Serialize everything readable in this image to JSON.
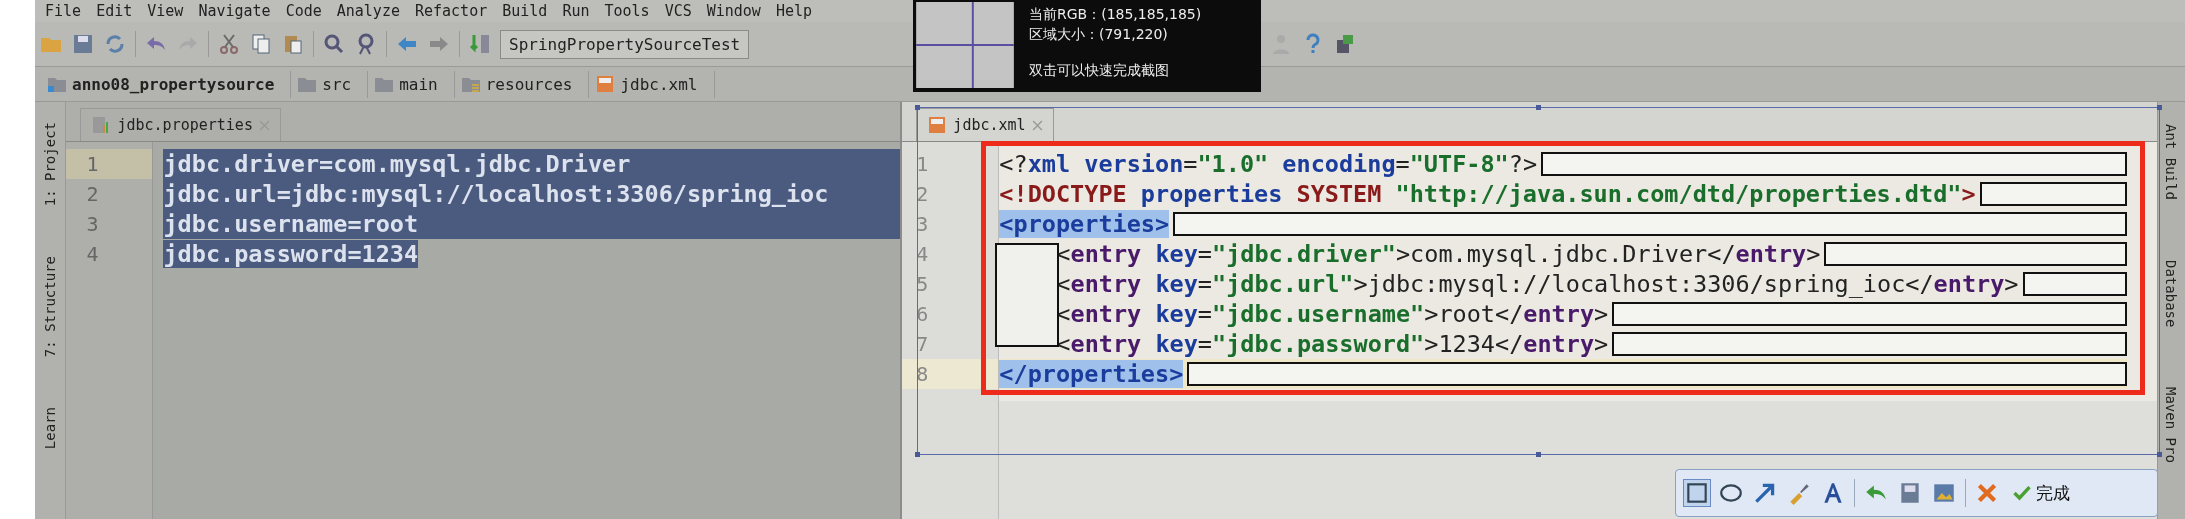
{
  "menu": [
    "File",
    "Edit",
    "View",
    "Navigate",
    "Code",
    "Analyze",
    "Refactor",
    "Build",
    "Run",
    "Tools",
    "VCS",
    "Window",
    "Help"
  ],
  "toolbar": {
    "run_config": "SpringPropertySourceTest"
  },
  "breadcrumbs": [
    {
      "label": "anno08_propertysource",
      "kind": "module"
    },
    {
      "label": "src",
      "kind": "folder"
    },
    {
      "label": "main",
      "kind": "folder"
    },
    {
      "label": "resources",
      "kind": "resources"
    },
    {
      "label": "jdbc.xml",
      "kind": "xml"
    }
  ],
  "left_tool_windows": [
    "1: Project",
    "7: Structure",
    "Learn"
  ],
  "right_tool_windows": [
    "Ant Build",
    "Database",
    "Maven Pro"
  ],
  "left_editor": {
    "tab": "jdbc.properties",
    "lines": [
      {
        "number": "1",
        "text": "jdbc.driver=com.mysql.jdbc.Driver",
        "selected": true,
        "full_width": true,
        "current": true
      },
      {
        "number": "2",
        "text": "jdbc.url=jdbc:mysql://localhost:3306/spring_ioc",
        "selected": true,
        "full_width": true,
        "current": false
      },
      {
        "number": "3",
        "text": "jdbc.username=root",
        "selected": true,
        "full_width": true,
        "current": false
      },
      {
        "number": "4",
        "text": "jdbc.password=1234",
        "selected": true,
        "full_width": false,
        "current": false
      }
    ]
  },
  "right_editor": {
    "tab": "jdbc.xml",
    "lines": [
      {
        "number": "1",
        "indented": false,
        "current": false,
        "tokens": [
          {
            "kind": "punct",
            "text": "<?"
          },
          {
            "kind": "attr",
            "text": "xml version"
          },
          {
            "kind": "punct",
            "text": "="
          },
          {
            "kind": "value",
            "text": "\"1.0\""
          },
          {
            "kind": "attr",
            "text": " encoding"
          },
          {
            "kind": "punct",
            "text": "="
          },
          {
            "kind": "value",
            "text": "\"UTF-8\""
          },
          {
            "kind": "punct",
            "text": "?>"
          }
        ]
      },
      {
        "number": "2",
        "indented": false,
        "current": false,
        "tokens": [
          {
            "kind": "keyword",
            "text": "<!DOCTYPE"
          },
          {
            "kind": "attr",
            "text": " properties"
          },
          {
            "kind": "keyword",
            "text": " SYSTEM"
          },
          {
            "kind": "value",
            "text": " \"http://java.sun.com/dtd/properties.dtd\""
          },
          {
            "kind": "keyword",
            "text": ">"
          }
        ]
      },
      {
        "number": "3",
        "indented": false,
        "current": false,
        "tokens": [
          {
            "kind": "matched",
            "text": "<properties>"
          }
        ]
      },
      {
        "number": "4",
        "indented": true,
        "current": false,
        "tokens": [
          {
            "kind": "punct",
            "text": "<"
          },
          {
            "kind": "tag",
            "text": "entry"
          },
          {
            "kind": "attr",
            "text": " key"
          },
          {
            "kind": "punct",
            "text": "="
          },
          {
            "kind": "value",
            "text": "\"jdbc.driver\""
          },
          {
            "kind": "punct",
            "text": ">"
          },
          {
            "kind": "text",
            "text": "com.mysql.jdbc.Driver"
          },
          {
            "kind": "punct",
            "text": "</"
          },
          {
            "kind": "tag",
            "text": "entry"
          },
          {
            "kind": "punct",
            "text": ">"
          }
        ]
      },
      {
        "number": "5",
        "indented": true,
        "current": false,
        "tokens": [
          {
            "kind": "punct",
            "text": "<"
          },
          {
            "kind": "tag",
            "text": "entry"
          },
          {
            "kind": "attr",
            "text": " key"
          },
          {
            "kind": "punct",
            "text": "="
          },
          {
            "kind": "value",
            "text": "\"jdbc.url\""
          },
          {
            "kind": "punct",
            "text": ">"
          },
          {
            "kind": "text",
            "text": "jdbc:mysql://localhost:3306/spring_ioc"
          },
          {
            "kind": "punct",
            "text": "</"
          },
          {
            "kind": "tag",
            "text": "entry"
          },
          {
            "kind": "punct",
            "text": ">"
          }
        ]
      },
      {
        "number": "6",
        "indented": true,
        "current": false,
        "tokens": [
          {
            "kind": "punct",
            "text": "<"
          },
          {
            "kind": "tag",
            "text": "entry"
          },
          {
            "kind": "attr",
            "text": " key"
          },
          {
            "kind": "punct",
            "text": "="
          },
          {
            "kind": "value",
            "text": "\"jdbc.username\""
          },
          {
            "kind": "punct",
            "text": ">"
          },
          {
            "kind": "text",
            "text": "root"
          },
          {
            "kind": "punct",
            "text": "</"
          },
          {
            "kind": "tag",
            "text": "entry"
          },
          {
            "kind": "punct",
            "text": ">"
          }
        ]
      },
      {
        "number": "7",
        "indented": true,
        "current": false,
        "tokens": [
          {
            "kind": "punct",
            "text": "<"
          },
          {
            "kind": "tag",
            "text": "entry"
          },
          {
            "kind": "attr",
            "text": " key"
          },
          {
            "kind": "punct",
            "text": "="
          },
          {
            "kind": "value",
            "text": "\"jdbc.password\""
          },
          {
            "kind": "punct",
            "text": ">"
          },
          {
            "kind": "text",
            "text": "1234"
          },
          {
            "kind": "punct",
            "text": "</"
          },
          {
            "kind": "tag",
            "text": "entry"
          },
          {
            "kind": "punct",
            "text": ">"
          }
        ]
      },
      {
        "number": "8",
        "indented": false,
        "current": true,
        "tokens": [
          {
            "kind": "matched",
            "text": "</properties>"
          }
        ]
      }
    ]
  },
  "capture_tooltip": {
    "lines": [
      "当前RGB：(185,185,185)",
      "区域大小：(791,220)",
      "双击可以快速完成截图"
    ]
  },
  "capture_toolbar": {
    "done": "完成"
  }
}
